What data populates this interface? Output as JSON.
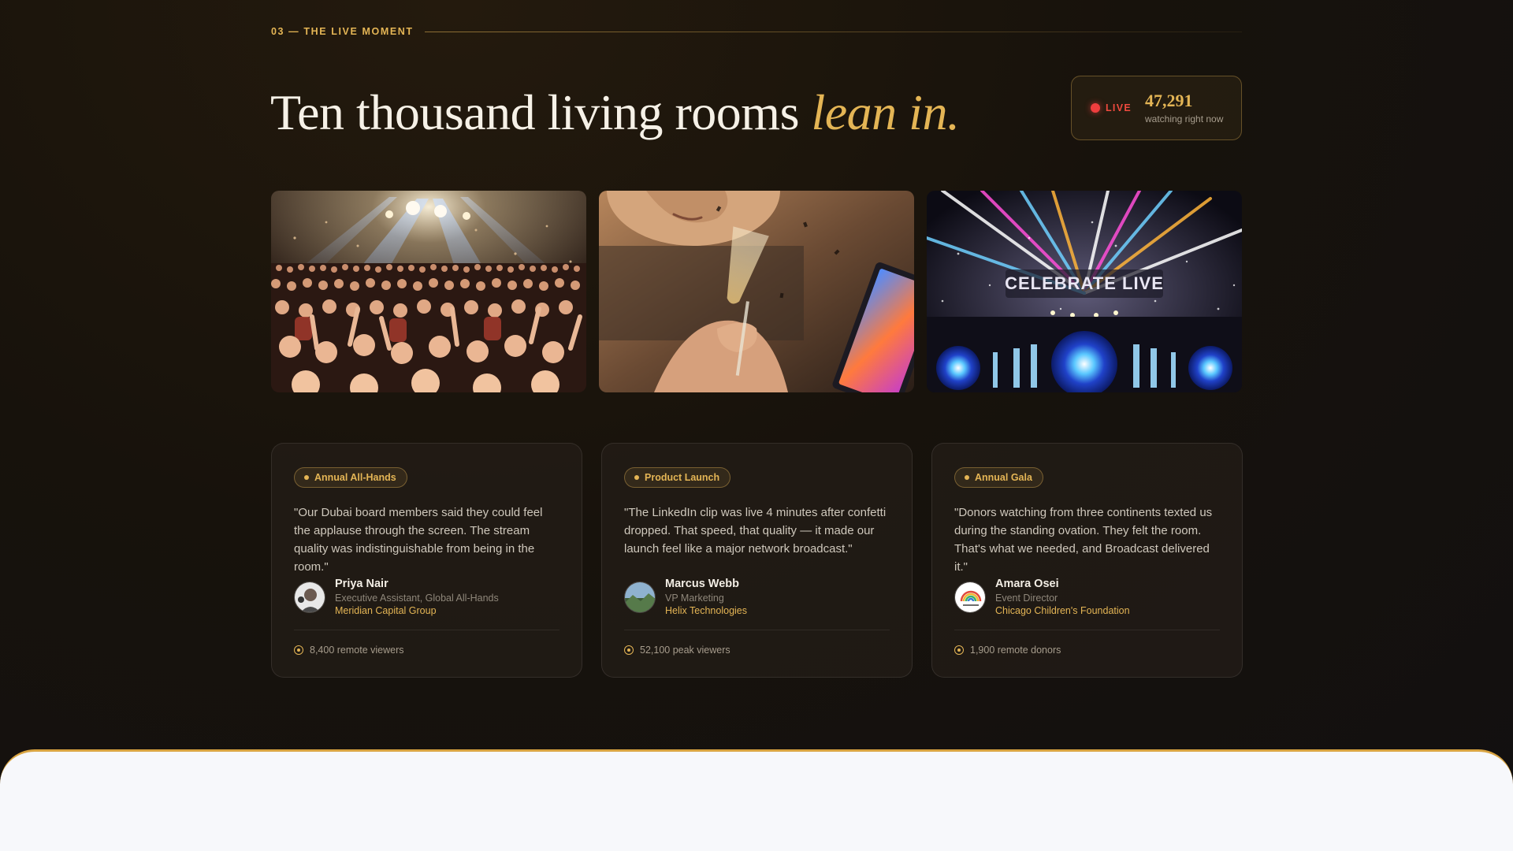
{
  "section": {
    "eyebrow": "03 — THE LIVE MOMENT"
  },
  "headline": {
    "main": "Ten thousand living rooms",
    "accent": "lean in."
  },
  "live": {
    "label": "LIVE",
    "count": "47,291",
    "sub": "watching right now"
  },
  "photos": [
    {
      "icon": "concert-crowd-photo"
    },
    {
      "icon": "champagne-viewer-photo"
    },
    {
      "icon": "celebrate-live-stage-photo",
      "sign_text": "CELEBRATE LIVE"
    }
  ],
  "testimonials": [
    {
      "tag": "Annual All-Hands",
      "quote": "\"Our Dubai board members said they could feel the applause through the screen. The stream quality was indistinguishable from being in the room.\"",
      "name": "Priya Nair",
      "role": "Executive Assistant, Global All-Hands",
      "org": "Meridian Capital Group",
      "metric": "8,400 remote viewers"
    },
    {
      "tag": "Product Launch",
      "quote": "\"The LinkedIn clip was live 4 minutes after confetti dropped. That speed, that quality — it made our launch feel like a major network broadcast.\"",
      "name": "Marcus Webb",
      "role": "VP Marketing",
      "org": "Helix Technologies",
      "metric": "52,100 peak viewers"
    },
    {
      "tag": "Annual Gala",
      "quote": "\"Donors watching from three continents texted us during the standing ovation. They felt the room. That's what we needed, and Broadcast delivered it.\"",
      "name": "Amara Osei",
      "role": "Event Director",
      "org": "Chicago Children's Foundation",
      "metric": "1,900 remote donors"
    }
  ],
  "colors": {
    "accent": "#e4b555",
    "live": "#ef3e3e",
    "background": "#17120c"
  }
}
